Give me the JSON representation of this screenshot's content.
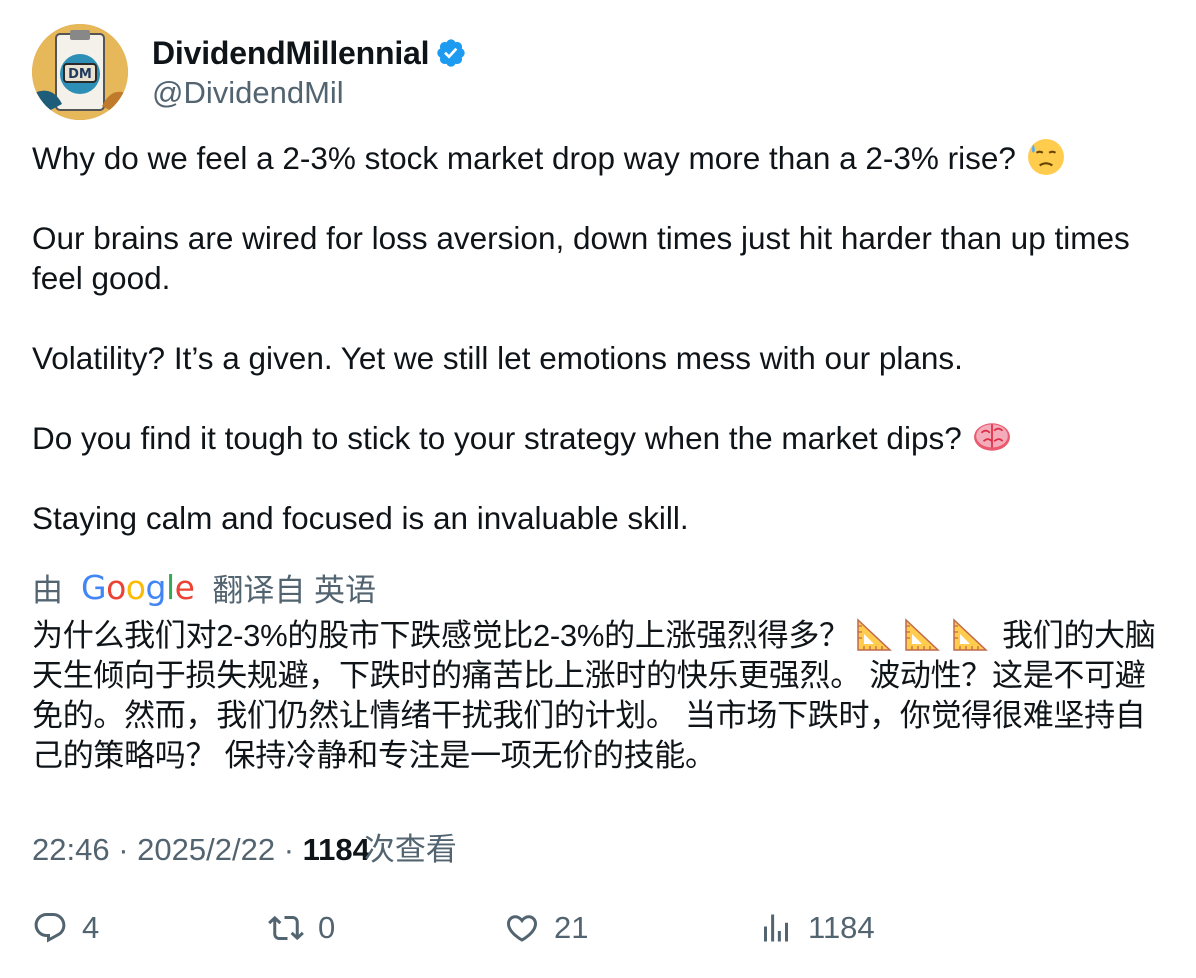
{
  "author": {
    "display_name": "DividendMillennial",
    "handle": "@DividendMil",
    "avatar_text": "DM",
    "verified_icon": "verified-badge-icon",
    "verified_color": "#1d9bf0"
  },
  "tweet": {
    "paragraphs": [
      "Why do we feel a 2-3% stock market drop way more than a 2-3% rise?",
      "Our brains are wired for loss aversion, down times just hit harder than up times feel good.",
      "Volatility? It’s a given. Yet we still let emotions mess with our plans.",
      "Do you find it tough to stick to your strategy when the market dips?",
      "Staying calm and focused is an invaluable skill."
    ],
    "emoji_1": "downcast-face-with-sweat-emoji",
    "emoji_2": "brain-emoji"
  },
  "translation": {
    "prefix": "由",
    "google": "Google",
    "suffix": "翻译自 英语",
    "part1": "为什么我们对2-3%的股市下跌感觉比2-3%的上涨强烈得多？",
    "part2": "我们的大脑天生倾向于损失规避，下跌时的痛苦比上涨时的快乐更强烈。 波动性？这是不可避免的。然而，我们仍然让情绪干扰我们的计划。 当市场下跌时，你觉得很难坚持自己的策略吗？ 保持冷静和专注是一项无价的技能。",
    "ruler_icon": "triangular-ruler-emoji"
  },
  "meta": {
    "time": "22:46",
    "sep": "·",
    "date": "2025/2/22",
    "views_count": "1184",
    "views_label": "次查看"
  },
  "actions": {
    "replies": "4",
    "retweets": "0",
    "likes": "21",
    "views": "1184"
  },
  "colors": {
    "text": "#0f1419",
    "secondary": "#536471",
    "brand_blue": "#1d9bf0"
  }
}
